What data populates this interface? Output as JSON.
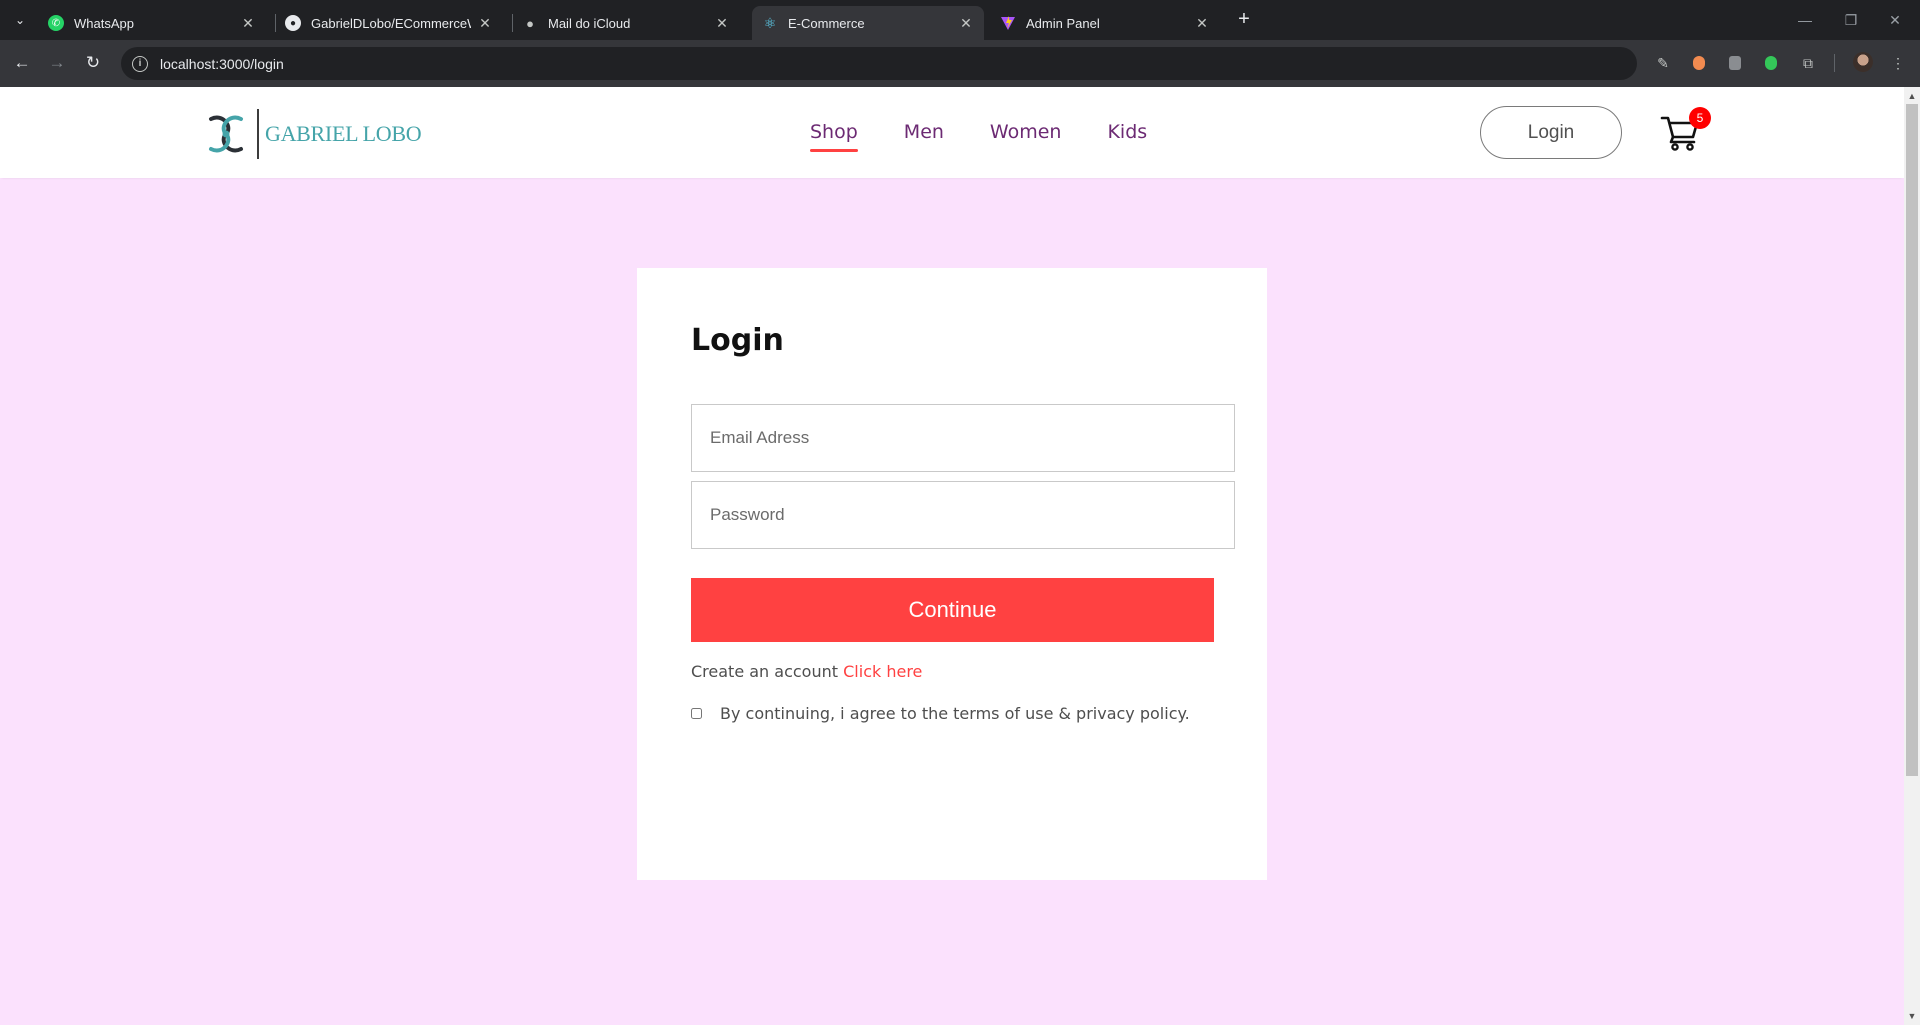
{
  "browser": {
    "tabs": [
      {
        "title": "WhatsApp",
        "icon": "whatsapp-icon"
      },
      {
        "title": "GabrielDLobo/ECommerceWith",
        "icon": "github-icon"
      },
      {
        "title": "Mail do iCloud",
        "icon": "apple-icon"
      },
      {
        "title": "E-Commerce",
        "icon": "react-icon",
        "active": true
      },
      {
        "title": "Admin Panel",
        "icon": "vite-icon"
      }
    ],
    "url": "localhost:3000/login"
  },
  "site": {
    "brand": "GABRIEL LOBO",
    "nav": [
      {
        "label": "Shop",
        "active": true
      },
      {
        "label": "Men"
      },
      {
        "label": "Women"
      },
      {
        "label": "Kids"
      }
    ],
    "login_button": "Login",
    "cart_count": "5"
  },
  "login": {
    "title": "Login",
    "email_placeholder": "Email Adress",
    "password_placeholder": "Password",
    "continue_label": "Continue",
    "signup_prompt": "Create an account",
    "signup_link": "Click here",
    "agree_text": "By continuing, i agree to the terms of use & privacy policy."
  },
  "colors": {
    "page_bg": "#fbe1fd",
    "accent": "#ff4141",
    "nav_text": "#6c2a73",
    "brand_teal": "#45a4a9"
  }
}
